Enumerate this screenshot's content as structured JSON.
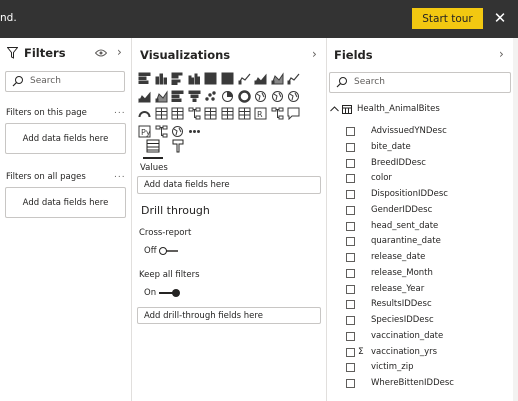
{
  "topbar": {
    "truncated_text": "nd.",
    "start_tour_label": "Start tour",
    "close_glyph": "✕"
  },
  "filters": {
    "title": "Filters",
    "search_placeholder": "Search",
    "on_this_page_label": "Filters on this page",
    "on_all_pages_label": "Filters on all pages",
    "add_fields_label": "Add data fields here",
    "more_glyph": "...",
    "chevron": "›",
    "icons": [
      "filter-icon",
      "eye-icon"
    ]
  },
  "visualizations": {
    "title": "Visualizations",
    "chevron": "›",
    "more_glyph": "···",
    "icon_names": [
      "stacked-bar-chart-icon",
      "stacked-column-chart-icon",
      "clustered-bar-chart-icon",
      "clustered-column-chart-icon",
      "100-stacked-bar-chart-icon",
      "100-stacked-column-chart-icon",
      "line-chart-icon",
      "area-chart-icon",
      "stacked-area-chart-icon",
      "line-and-column-chart-icon",
      "line-and-clustered-column-chart-icon",
      "ribbon-chart-icon",
      "waterfall-chart-icon",
      "funnel-chart-icon",
      "scatter-chart-icon",
      "pie-chart-icon",
      "donut-chart-icon",
      "treemap-icon",
      "map-icon",
      "filled-map-icon",
      "gauge-icon",
      "card-icon",
      "multi-row-card-icon",
      "kpi-icon",
      "slicer-icon",
      "table-icon",
      "matrix-icon",
      "r-visual-icon",
      "key-influencers-icon",
      "qna-icon",
      "python-visual-icon",
      "decomposition-tree-icon",
      "arcgis-map-icon",
      "more-visuals-icon"
    ],
    "values_label": "Values",
    "values_dropzone": "Add data fields here",
    "drill_through_title": "Drill through",
    "cross_report_label": "Cross-report",
    "cross_report_state": "Off",
    "keep_all_filters_label": "Keep all filters",
    "keep_all_filters_state": "On",
    "drill_dropzone": "Add drill-through fields here"
  },
  "fields": {
    "title": "Fields",
    "chevron": "›",
    "search_placeholder": "Search",
    "table_name": "Health_AnimalBites",
    "items": [
      {
        "name": "AdvissuedYNDesc",
        "sigma": false
      },
      {
        "name": "bite_date",
        "sigma": false
      },
      {
        "name": "BreedIDDesc",
        "sigma": false
      },
      {
        "name": "color",
        "sigma": false
      },
      {
        "name": "DispositionIDDesc",
        "sigma": false
      },
      {
        "name": "GenderIDDesc",
        "sigma": false
      },
      {
        "name": "head_sent_date",
        "sigma": false
      },
      {
        "name": "quarantine_date",
        "sigma": false
      },
      {
        "name": "release_date",
        "sigma": false
      },
      {
        "name": "release_Month",
        "sigma": false
      },
      {
        "name": "release_Year",
        "sigma": false
      },
      {
        "name": "ResultsIDDesc",
        "sigma": false
      },
      {
        "name": "SpeciesIDDesc",
        "sigma": false
      },
      {
        "name": "vaccination_date",
        "sigma": false
      },
      {
        "name": "vaccination_yrs",
        "sigma": true
      },
      {
        "name": "victim_zip",
        "sigma": false
      },
      {
        "name": "WhereBittenIDDesc",
        "sigma": false
      }
    ]
  },
  "colors": {
    "accent_yellow": "#f2c811",
    "topbar_bg": "#333333",
    "icon_blue": "#3a3a3a",
    "toggle_on": "#252423"
  }
}
